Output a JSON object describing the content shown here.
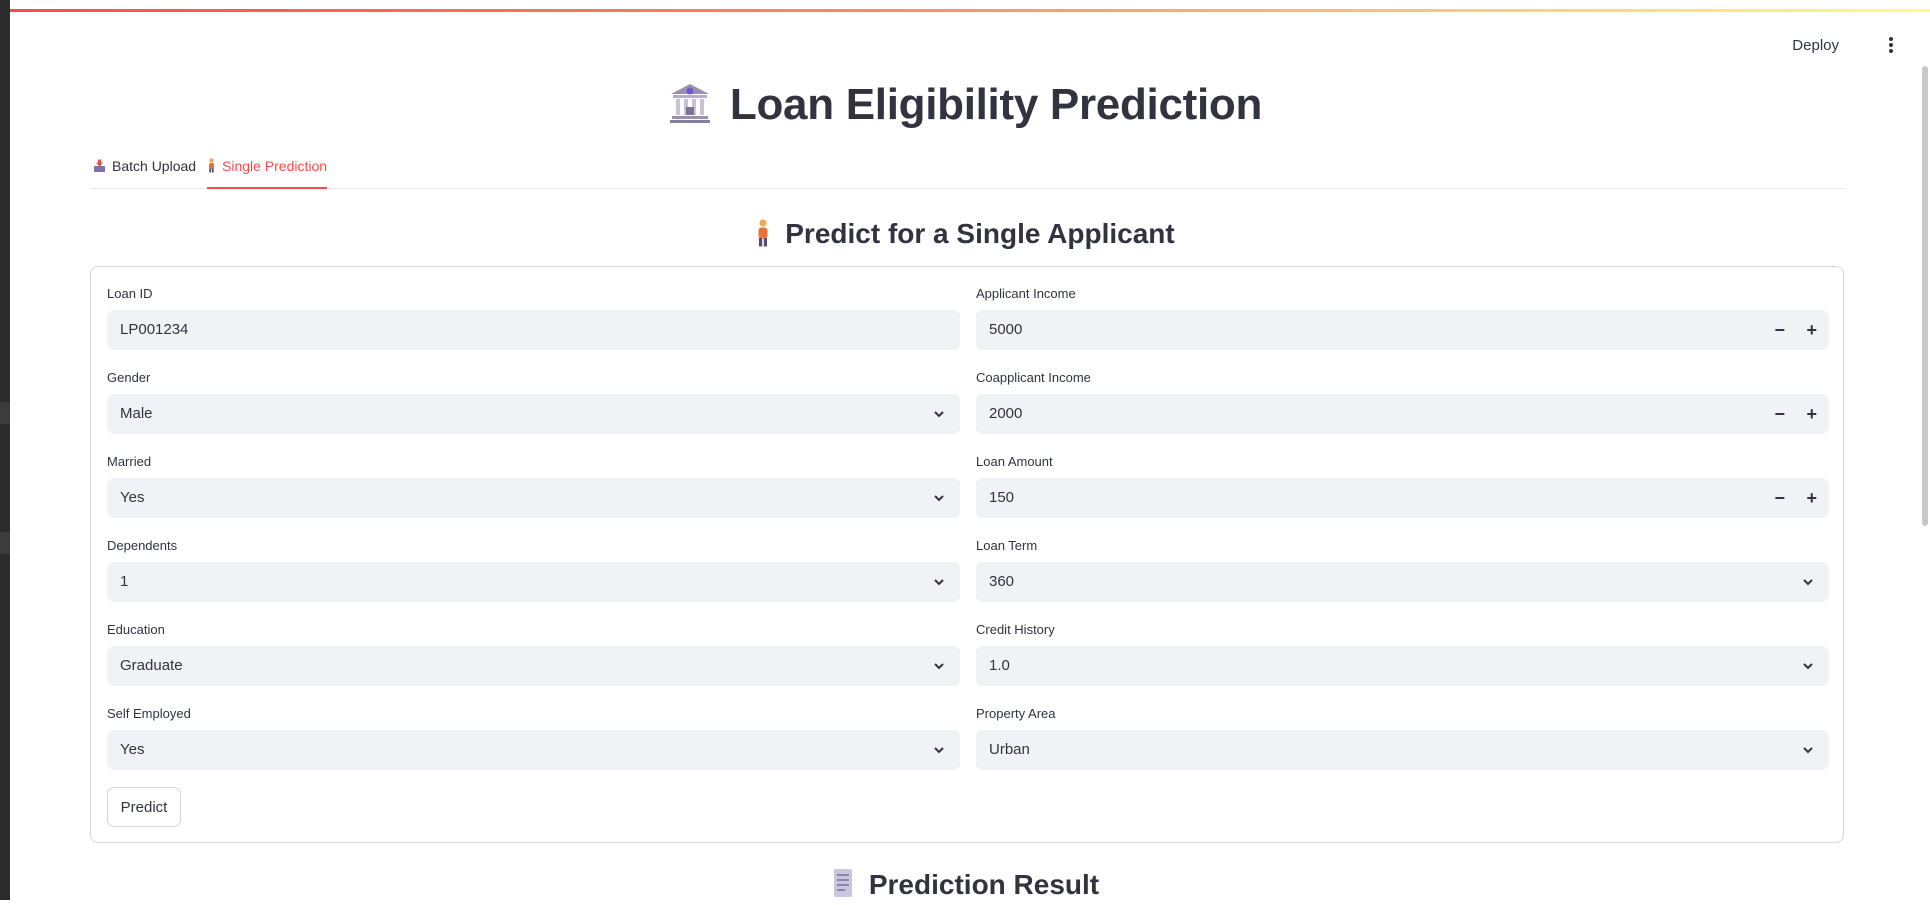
{
  "header": {
    "deploy_label": "Deploy"
  },
  "page": {
    "title": "Loan Eligibility Prediction"
  },
  "tabs": [
    {
      "label": "Batch Upload",
      "active": false
    },
    {
      "label": "Single Prediction",
      "active": true
    }
  ],
  "single": {
    "heading": "Predict for a Single Applicant",
    "fields": {
      "loan_id": {
        "label": "Loan ID",
        "value": "LP001234"
      },
      "gender": {
        "label": "Gender",
        "value": "Male"
      },
      "married": {
        "label": "Married",
        "value": "Yes"
      },
      "dependents": {
        "label": "Dependents",
        "value": "1"
      },
      "education": {
        "label": "Education",
        "value": "Graduate"
      },
      "self_employed": {
        "label": "Self Employed",
        "value": "Yes"
      },
      "applicant_income": {
        "label": "Applicant Income",
        "value": "5000"
      },
      "coapplicant_income": {
        "label": "Coapplicant Income",
        "value": "2000"
      },
      "loan_amount": {
        "label": "Loan Amount",
        "value": "150"
      },
      "loan_term": {
        "label": "Loan Term",
        "value": "360"
      },
      "credit_history": {
        "label": "Credit History",
        "value": "1.0"
      },
      "property_area": {
        "label": "Property Area",
        "value": "Urban"
      }
    },
    "predict_label": "Predict"
  },
  "result": {
    "heading": "Prediction Result"
  },
  "colors": {
    "accent": "#ff4b4b",
    "input_bg": "#f0f2f6",
    "text": "#31333f"
  }
}
